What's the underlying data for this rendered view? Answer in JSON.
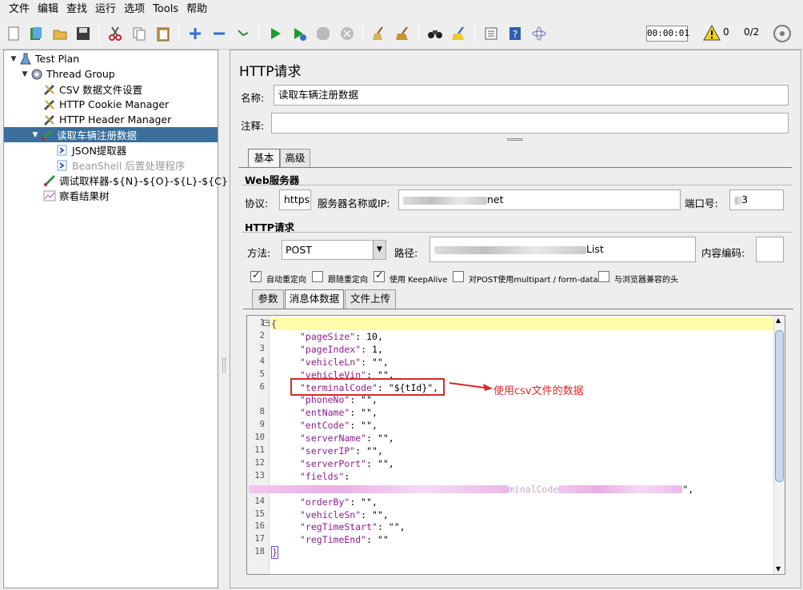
{
  "menu": [
    "文件",
    "编辑",
    "查找",
    "运行",
    "选项",
    "Tools",
    "帮助"
  ],
  "toolbar": {
    "timer": "00:00:01",
    "warnings": "0",
    "threads": "0/2"
  },
  "tree": [
    {
      "label": "Test Plan",
      "depth": 0,
      "icon": "flask-icon",
      "toggle": "▼"
    },
    {
      "label": "Thread Group",
      "depth": 1,
      "icon": "gear-icon",
      "toggle": "▼"
    },
    {
      "label": "CSV 数据文件设置",
      "depth": 2,
      "icon": "wrench-icon",
      "toggle": ""
    },
    {
      "label": "HTTP Cookie Manager",
      "depth": 2,
      "icon": "wrench-icon",
      "toggle": ""
    },
    {
      "label": "HTTP Header Manager",
      "depth": 2,
      "icon": "wrench-icon",
      "toggle": ""
    },
    {
      "label": "读取车辆注册数据",
      "depth": 2,
      "icon": "sampler-icon",
      "toggle": "▼",
      "selected": true
    },
    {
      "label": "JSON提取器",
      "depth": 3,
      "icon": "extractor-icon",
      "toggle": ""
    },
    {
      "label": "BeanShell 后置处理程序",
      "depth": 3,
      "icon": "extractor-icon",
      "toggle": "",
      "disabled": true
    },
    {
      "label": "调试取样器-${N}-${O}-${L}-${C}",
      "depth": 2,
      "icon": "sampler-icon",
      "toggle": ""
    },
    {
      "label": "察看结果树",
      "depth": 2,
      "icon": "chart-icon",
      "toggle": ""
    }
  ],
  "panel": {
    "title": "HTTP请求",
    "name_label": "名称:",
    "name_value": "读取车辆注册数据",
    "comment_label": "注释:",
    "comment_value": "",
    "tabs": [
      "基本",
      "高级"
    ],
    "web_server_title": "Web服务器",
    "protocol_label": "协议:",
    "protocol_value": "https",
    "server_label": "服务器名称或IP:",
    "server_value_suffix": "net",
    "port_label": "端口号:",
    "port_value_suffix": "3",
    "http_request_title": "HTTP请求",
    "method_label": "方法:",
    "method_value": "POST",
    "path_label": "路径:",
    "path_value_suffix": "List",
    "encoding_label": "内容编码:",
    "encoding_value": "",
    "checkboxes": [
      {
        "label": "自动重定向",
        "checked": true
      },
      {
        "label": "跟随重定向",
        "checked": false
      },
      {
        "label": "使用 KeepAlive",
        "checked": true
      },
      {
        "label": "对POST使用multipart / form-data",
        "checked": false
      },
      {
        "label": "与浏览器兼容的头",
        "checked": false
      }
    ],
    "body_tabs": [
      "参数",
      "消息体数据",
      "文件上传"
    ]
  },
  "code_lines": [
    {
      "n": "1",
      "text": "{"
    },
    {
      "n": "2",
      "key": "\"pageSize\"",
      "rest": ": 10,"
    },
    {
      "n": "3",
      "key": "\"pageIndex\"",
      "rest": ": 1,"
    },
    {
      "n": "4",
      "key": "\"vehicleLn\"",
      "rest": ": \"\","
    },
    {
      "n": "5",
      "key": "\"vehicleVin\"",
      "rest": ": \"\","
    },
    {
      "n": "6",
      "key": "\"terminalCode\"",
      "rest": ": \"${tId}\","
    },
    {
      "n": "",
      "key": "\"phoneNo\"",
      "rest": ": \"\","
    },
    {
      "n": "8",
      "key": "\"entName\"",
      "rest": ": \"\","
    },
    {
      "n": "9",
      "key": "\"entCode\"",
      "rest": ": \"\","
    },
    {
      "n": "10",
      "key": "\"serverName\"",
      "rest": ": \"\","
    },
    {
      "n": "11",
      "key": "\"serverIP\"",
      "rest": ": \"\","
    },
    {
      "n": "12",
      "key": "\"serverPort\"",
      "rest": ": \"\","
    },
    {
      "n": "13",
      "key": "\"fields\"",
      "rest": ":"
    },
    {
      "n": "",
      "key": "",
      "rest": "minalCode",
      "wrapped": true
    },
    {
      "n": "14",
      "key": "\"orderBy\"",
      "rest": ": \"\","
    },
    {
      "n": "15",
      "key": "\"vehicleSn\"",
      "rest": ": \"\","
    },
    {
      "n": "16",
      "key": "\"regTimeStart\"",
      "rest": ": \"\","
    },
    {
      "n": "17",
      "key": "\"regTimeEnd\"",
      "rest": ": \"\""
    },
    {
      "n": "18",
      "text": "}"
    }
  ],
  "annotation": "使用csv文件的数据",
  "colors": {
    "selection": "#3a6f9c",
    "annotation": "#d32a2a",
    "json_key": "#8e1d8e",
    "highlight_line": "#fffcaa"
  }
}
